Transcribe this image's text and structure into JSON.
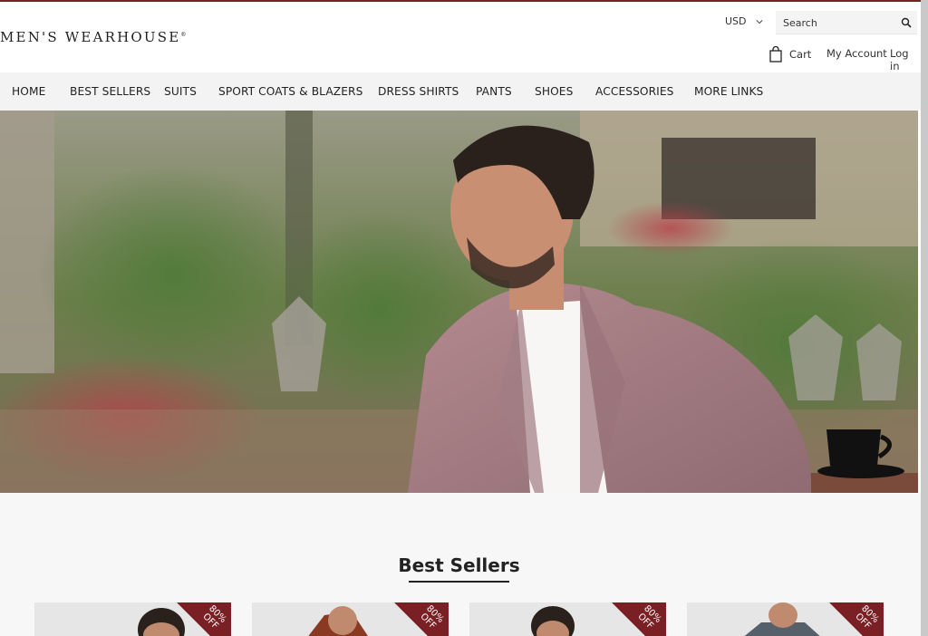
{
  "brand": {
    "logo_text": "MEN'S WEARHOUSE",
    "logo_mark": "®"
  },
  "header": {
    "currency": "USD",
    "search_placeholder": "Search",
    "cart_label": "Cart",
    "account_label": "My Account",
    "login_label": "Log in"
  },
  "nav": {
    "items": [
      {
        "label": "HOME"
      },
      {
        "label": "BEST SELLERS"
      },
      {
        "label": "SUITS"
      },
      {
        "label": "SPORT COATS & BLAZERS"
      },
      {
        "label": "DRESS SHIRTS"
      },
      {
        "label": "PANTS"
      },
      {
        "label": "SHOES"
      },
      {
        "label": "ACCESSORIES"
      },
      {
        "label": "MORE LINKS"
      }
    ]
  },
  "hero": {
    "image": "man-in-plaid-sport-coat-outdoor-cafe"
  },
  "best_sellers": {
    "title": "Best Sellers",
    "products": [
      {
        "badge_line1": "80%",
        "badge_line2": "OFF"
      },
      {
        "badge_line1": "80%",
        "badge_line2": "OFF"
      },
      {
        "badge_line1": "80%",
        "badge_line2": "OFF"
      },
      {
        "badge_line1": "80%",
        "badge_line2": "OFF"
      }
    ]
  },
  "colors": {
    "accent": "#7a1f23",
    "nav_bg": "#f3f3f3",
    "badge": "#7a1f23"
  }
}
